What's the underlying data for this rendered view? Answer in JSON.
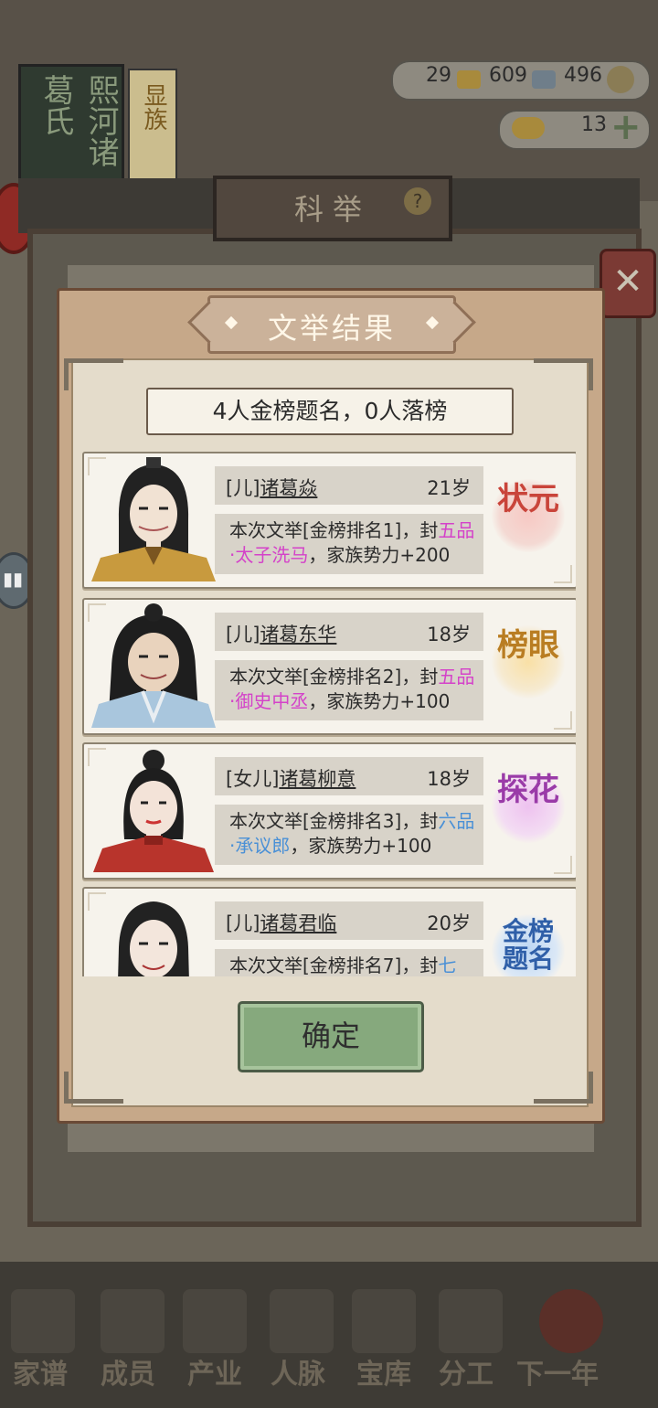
{
  "background": {
    "sign_text": "熙河诸葛氏",
    "tag_text": "显族",
    "resources": {
      "a": "29",
      "b": "609",
      "c": "496",
      "d": "13"
    },
    "outer_title": "科举",
    "outer_help": "?",
    "close": "✕",
    "nav": [
      "家谱",
      "成员",
      "产业",
      "人脉",
      "宝库",
      "分工",
      "下一年"
    ]
  },
  "dialog": {
    "title": "文举结果",
    "summary": "4人金榜题名，0人落榜",
    "confirm_label": "确定",
    "results": [
      {
        "relation": "[儿]",
        "name": "诸葛焱",
        "age": "21岁",
        "desc_prefix": "本次文举[金榜排名1]，封",
        "rank": "五品·太子洗马",
        "desc_suffix": "，家族势力+200",
        "stamp": "状元",
        "stamp_color": "#d9534f",
        "rank_color": "pink"
      },
      {
        "relation": "[儿]",
        "name": "诸葛东华",
        "age": "18岁",
        "desc_prefix": "本次文举[金榜排名2]，封",
        "rank": "五品·御史中丞",
        "desc_suffix": "，家族势力+100",
        "stamp": "榜眼",
        "stamp_color": "#c9932e",
        "rank_color": "pink"
      },
      {
        "relation": "[女儿]",
        "name": "诸葛柳意",
        "age": "18岁",
        "desc_prefix": "本次文举[金榜排名3]，封",
        "rank": "六品·承议郎",
        "desc_suffix": "，家族势力+100",
        "stamp": "探花",
        "stamp_color": "#a54fb8",
        "rank_color": "blue"
      },
      {
        "relation": "[儿]",
        "name": "诸葛君临",
        "age": "20岁",
        "desc_prefix": "本次文举[金榜排名7]，封",
        "rank": "七",
        "desc_suffix": "",
        "stamp": "金榜题名",
        "stamp_color": "#3d6fb8",
        "rank_color": "blue"
      }
    ]
  }
}
